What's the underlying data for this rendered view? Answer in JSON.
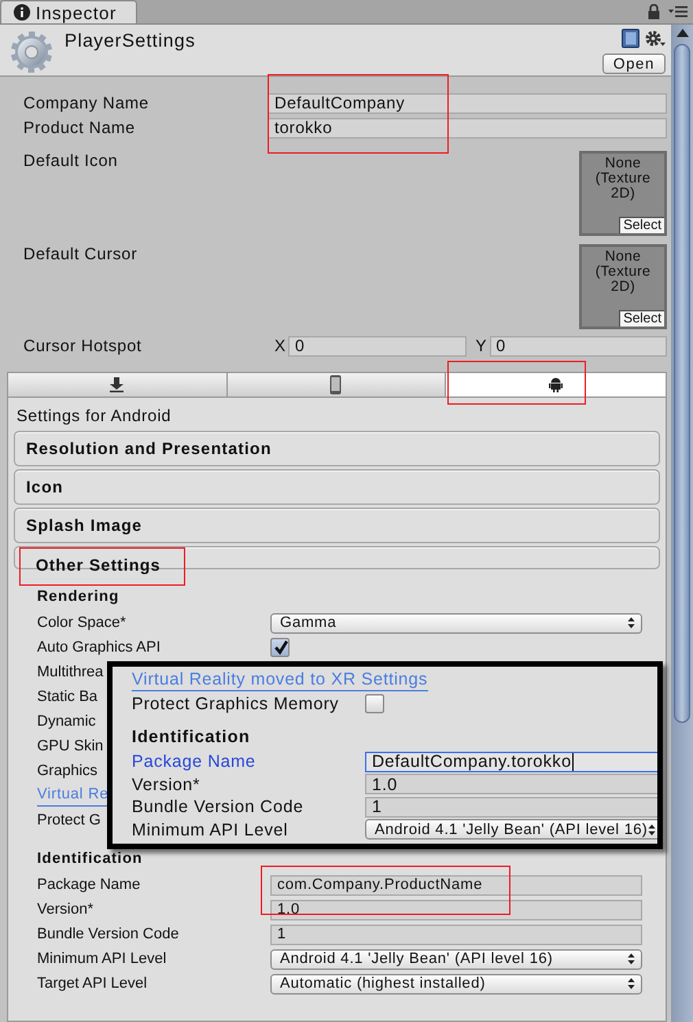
{
  "window": {
    "tab": "Inspector"
  },
  "header": {
    "title": "PlayerSettings",
    "open_button": "Open"
  },
  "fields": [
    {
      "kind": "text",
      "label": "Company Name",
      "value": "DefaultCompany"
    },
    {
      "kind": "text",
      "label": "Product Name",
      "value": "torokko"
    },
    {
      "kind": "texture",
      "label": "Default Icon",
      "value": "None (Texture 2D)",
      "button": "Select"
    },
    {
      "kind": "texture",
      "label": "Default Cursor",
      "value": "None (Texture 2D)",
      "button": "Select"
    },
    {
      "kind": "vector",
      "label": "Cursor Hotspot",
      "x_label": "X",
      "x_value": "0",
      "y_label": "Y",
      "y_value": "0"
    }
  ],
  "platform_tabs": [
    {
      "kind": "standalone",
      "selected": false
    },
    {
      "kind": "mobile",
      "selected": false
    },
    {
      "kind": "android",
      "selected": true
    }
  ],
  "settings_title": "Settings for Android",
  "sections": [
    {
      "title": "Resolution and Presentation",
      "expanded": false
    },
    {
      "title": "Icon",
      "expanded": false
    },
    {
      "title": "Splash Image",
      "expanded": false
    },
    {
      "title": "Other Settings",
      "expanded": true,
      "rows": [
        {
          "kind": "heading",
          "label": "Rendering"
        },
        {
          "kind": "dropdown",
          "label": "Color Space*",
          "value": "Gamma"
        },
        {
          "kind": "checkbox",
          "label": "Auto Graphics API",
          "checked": true
        },
        {
          "kind": "label",
          "label": "Multithrea"
        },
        {
          "kind": "label",
          "label": "Static Ba"
        },
        {
          "kind": "label",
          "label": "Dynamic"
        },
        {
          "kind": "label",
          "label": "GPU Skin"
        },
        {
          "kind": "label",
          "label": "Graphics"
        },
        {
          "kind": "link",
          "label": "Virtual Re"
        },
        {
          "kind": "label",
          "label": "Protect G"
        },
        {
          "kind": "heading",
          "label": "Identification"
        },
        {
          "kind": "text",
          "label": "Package Name",
          "value": "com.Company.ProductName",
          "focused": false
        },
        {
          "kind": "text",
          "label": "Version*",
          "value": "1.0",
          "focused": false
        },
        {
          "kind": "text",
          "label": "Bundle Version Code",
          "value": "1",
          "focused": false
        },
        {
          "kind": "dropdown",
          "label": "Minimum API Level",
          "value": "Android 4.1 'Jelly Bean' (API level 16)"
        },
        {
          "kind": "dropdown",
          "label": "Target API Level",
          "value": "Automatic (highest installed)"
        }
      ]
    }
  ],
  "zoom_inset": {
    "rows": [
      {
        "kind": "link",
        "label": "Virtual Reality moved to XR Settings"
      },
      {
        "kind": "checkbox",
        "label": "Protect Graphics Memory",
        "checked": false
      },
      {
        "kind": "heading",
        "label": "Identification"
      },
      {
        "kind": "text",
        "label": "Package Name",
        "value": "DefaultCompany.torokko",
        "focused": true
      },
      {
        "kind": "text",
        "label": "Version*",
        "value": "1.0",
        "focused": false
      },
      {
        "kind": "text",
        "label": "Bundle Version Code",
        "value": "1",
        "focused": false
      },
      {
        "kind": "dropdown",
        "label": "Minimum API Level",
        "value": "Android 4.1 'Jelly Bean' (API level 16)"
      }
    ]
  }
}
